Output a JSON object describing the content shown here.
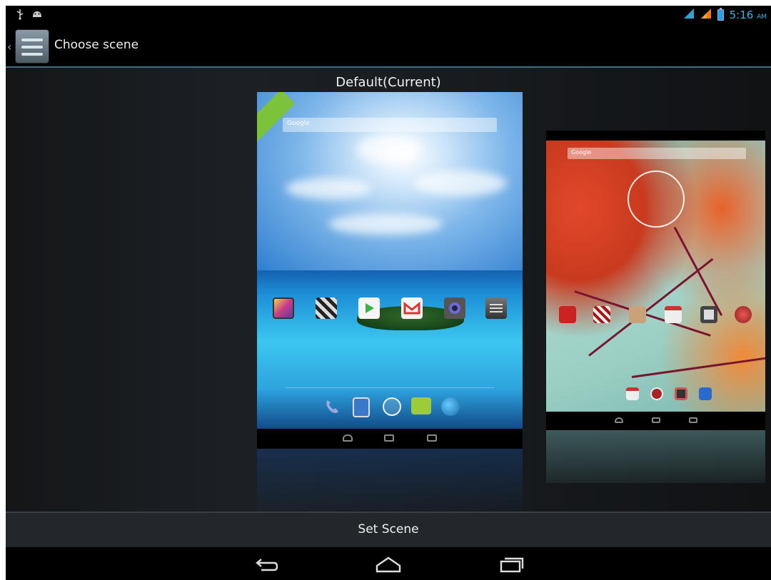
{
  "status_bar": {
    "time": "5:16",
    "ampm": "AM",
    "left_icons": [
      "usb-icon",
      "android-debug-icon"
    ],
    "right_icons": [
      "wifi-signal-icon",
      "cell-signal-icon",
      "battery-icon"
    ],
    "accent_color": "#33b5e5"
  },
  "action_bar": {
    "title": "Choose scene",
    "icon": "scene-settings-icon"
  },
  "scenes": [
    {
      "label": "Default(Current)",
      "current": true,
      "search_placeholder": "Google",
      "home_icons": [
        "gallery-icon",
        "movie-studio-icon",
        "play-store-icon",
        "gmail-icon",
        "camera-icon",
        "settings-icon"
      ],
      "dock_icons": [
        "phone-icon",
        "contacts-icon",
        "apps-icon",
        "messaging-icon",
        "browser-icon"
      ]
    },
    {
      "label": "",
      "current": false,
      "search_placeholder": "Google",
      "home_icons": [
        "gallery-icon",
        "movie-studio-icon",
        "folder-icon",
        "gmail-icon",
        "camera-icon",
        "browser-icon"
      ],
      "dock_icons": [
        "phone-icon",
        "calendar-icon",
        "apps-icon",
        "camera-icon",
        "email-icon"
      ]
    }
  ],
  "footer": {
    "button_label": "Set Scene"
  },
  "nav_bar": {
    "buttons": [
      "back-icon",
      "home-icon",
      "recent-apps-icon"
    ]
  }
}
